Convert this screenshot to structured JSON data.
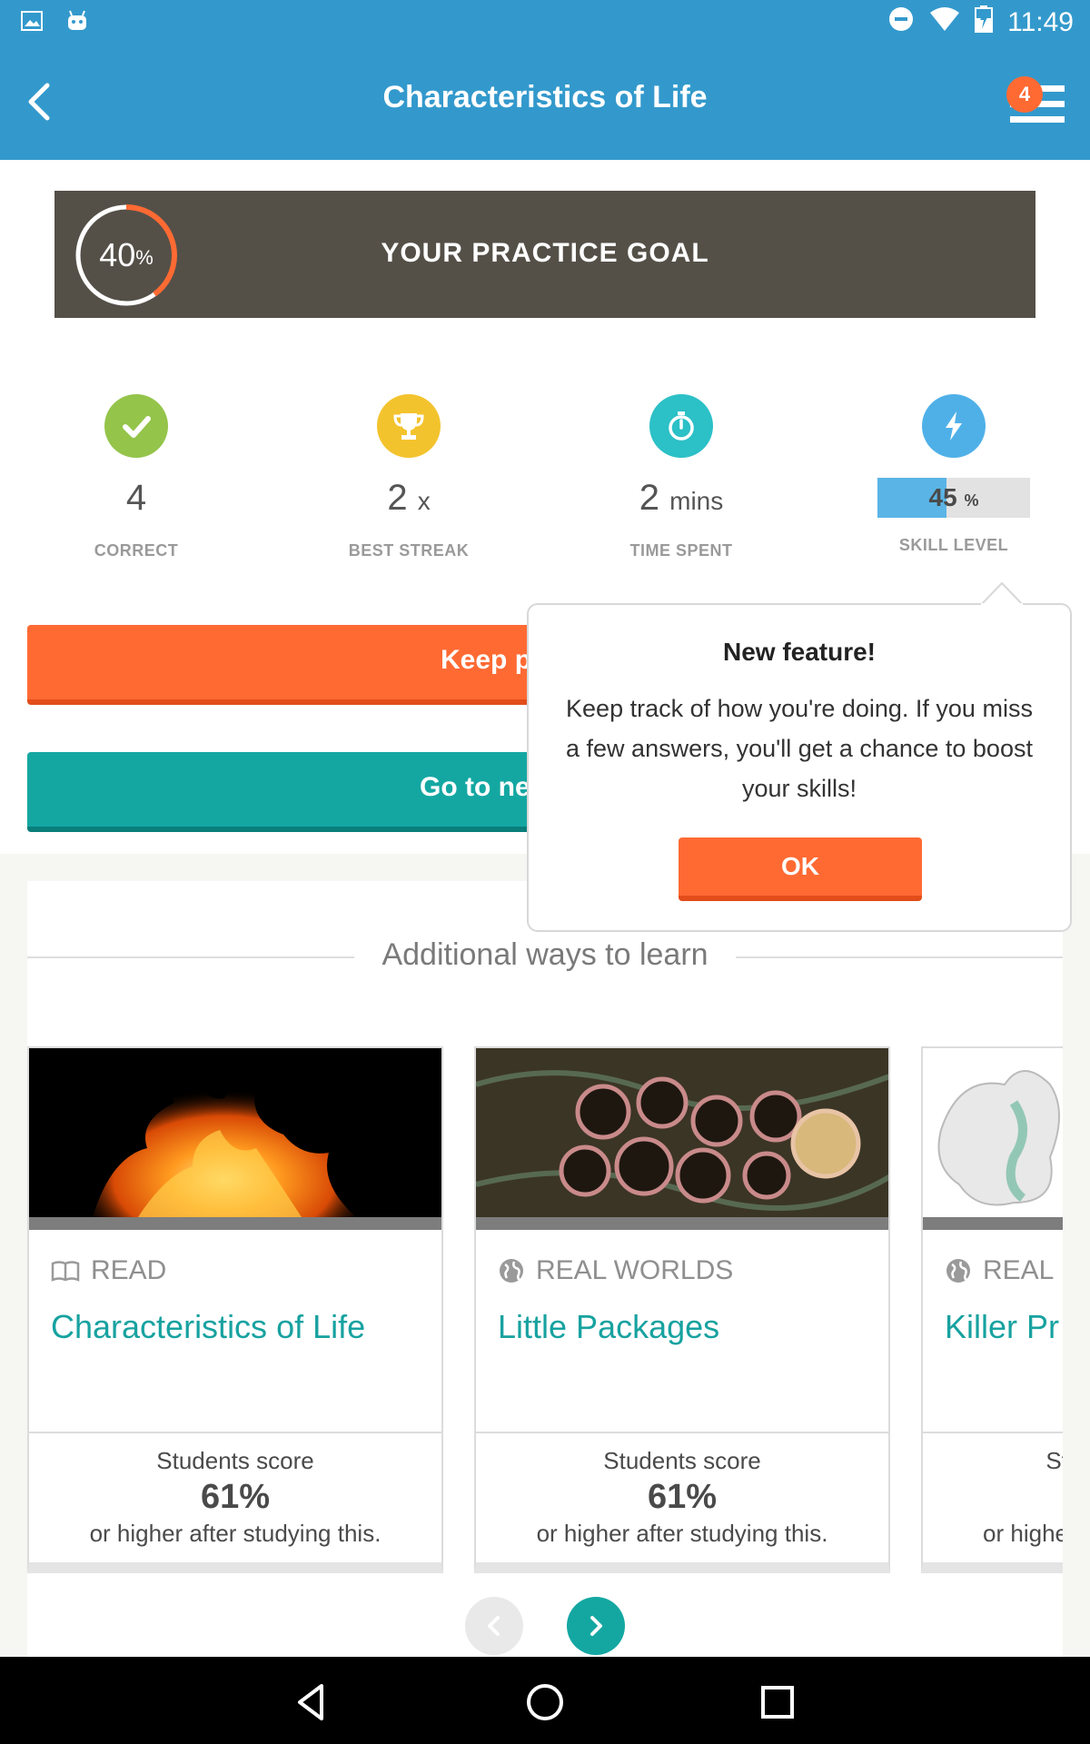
{
  "status_bar": {
    "time": "11:49"
  },
  "app_bar": {
    "title": "Characteristics of Life",
    "menu_badge": "4"
  },
  "practice_goal": {
    "percent": "40",
    "percent_symbol": "%",
    "progress": 0.4,
    "label": "YOUR PRACTICE GOAL"
  },
  "stats": {
    "correct": {
      "value": "4",
      "label": "CORRECT"
    },
    "best_streak": {
      "value": "2",
      "unit": "x",
      "label": "BEST STREAK"
    },
    "time_spent": {
      "value": "2",
      "unit": "mins",
      "label": "TIME SPENT"
    },
    "skill_level": {
      "value": "45",
      "unit": "%",
      "fill_percent": 45,
      "label": "SKILL LEVEL"
    }
  },
  "buttons": {
    "keep_practicing": "Keep p",
    "go_next": "Go to ne"
  },
  "popover": {
    "title": "New feature!",
    "body": "Keep track of how you're doing. If you miss a few answers, you'll get a chance to boost your skills!",
    "ok": "OK"
  },
  "section": {
    "title": "Additional ways to learn"
  },
  "cards": [
    {
      "type": "READ",
      "icon": "book-icon",
      "title": "Characteristics of Life",
      "score_intro": "Students score",
      "score": "61%",
      "score_suffix": "or higher after studying this."
    },
    {
      "type": "REAL WORLDS",
      "icon": "globe-icon",
      "title": "Little Packages",
      "score_intro": "Students score",
      "score": "61%",
      "score_suffix": "or higher after studying this."
    },
    {
      "type": "REAL",
      "icon": "globe-icon",
      "title": "Killer Pr",
      "score_intro": "St",
      "score_suffix": "or highe"
    }
  ],
  "colors": {
    "brand_blue": "#3399cc",
    "accent_orange": "#ff6a33",
    "teal": "#14a7a2",
    "goal_bg": "#545048"
  }
}
